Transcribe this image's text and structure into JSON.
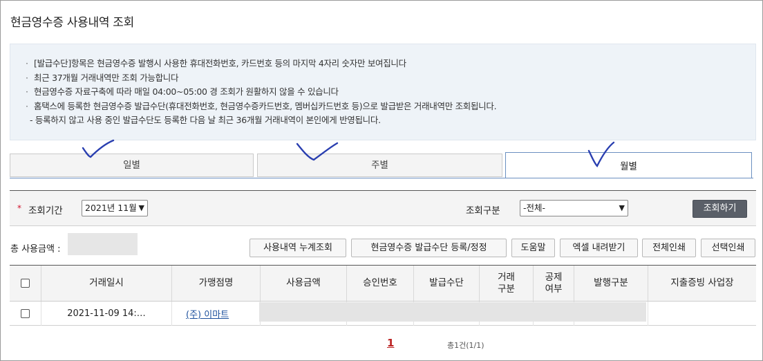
{
  "page": {
    "title": "현금영수증 사용내역 조회"
  },
  "notice": {
    "lines": [
      "[발급수단]항목은 현금영수증 발행시 사용한 휴대전화번호, 카드번호 등의 마지막 4자리 숫자만 보여집니다",
      "최근 37개월 거래내역만 조회 가능합니다",
      "현금영수증 자료구축에 따라 매일 04:00~05:00 경 조회가 원활하지 않을 수 있습니다",
      "홈택스에 등록한 현금영수증 발급수단(휴대전화번호, 현금영수증카드번호, 멤버십카드번호 등)으로 발급받은 거래내역만 조회됩니다.",
      "- 등록하지 않고 사용 중인 발급수단도 등록한 다음 날 최근 36개월 거래내역이 본인에게 반영됩니다."
    ]
  },
  "tabs": [
    {
      "label": "일별",
      "active": false
    },
    {
      "label": "주별",
      "active": false
    },
    {
      "label": "월별",
      "active": true
    }
  ],
  "annotation_color": "#2a3fb0",
  "search": {
    "required_mark": "*",
    "period_label": "조회기간",
    "period_value": "2021년 11월",
    "type_label": "조회구분",
    "type_value": "-전체-",
    "search_button": "조회하기"
  },
  "summary": {
    "total_label": "총 사용금액 :"
  },
  "actions": {
    "history_sum": "사용내역 누계조회",
    "register_method": "현금영수증 발급수단 등록/정정",
    "help": "도움말",
    "excel": "엑셀 내려받기",
    "print_all": "전체인쇄",
    "print_selected": "선택인쇄"
  },
  "table": {
    "headers": {
      "date": "거래일시",
      "merchant": "가맹점명",
      "amount": "사용금액",
      "approval": "승인번호",
      "method": "발급수단",
      "trade_type_1": "거래",
      "trade_type_2": "구분",
      "deduction_1": "공제",
      "deduction_2": "여부",
      "issue_type": "발행구분",
      "business": "지출증빙 사업장"
    },
    "rows": [
      {
        "date": "2021-11-09 14:…",
        "merchant": "(주) 이마트"
      }
    ]
  },
  "pagination": {
    "current": "1",
    "info": "총1건(1/1)"
  }
}
